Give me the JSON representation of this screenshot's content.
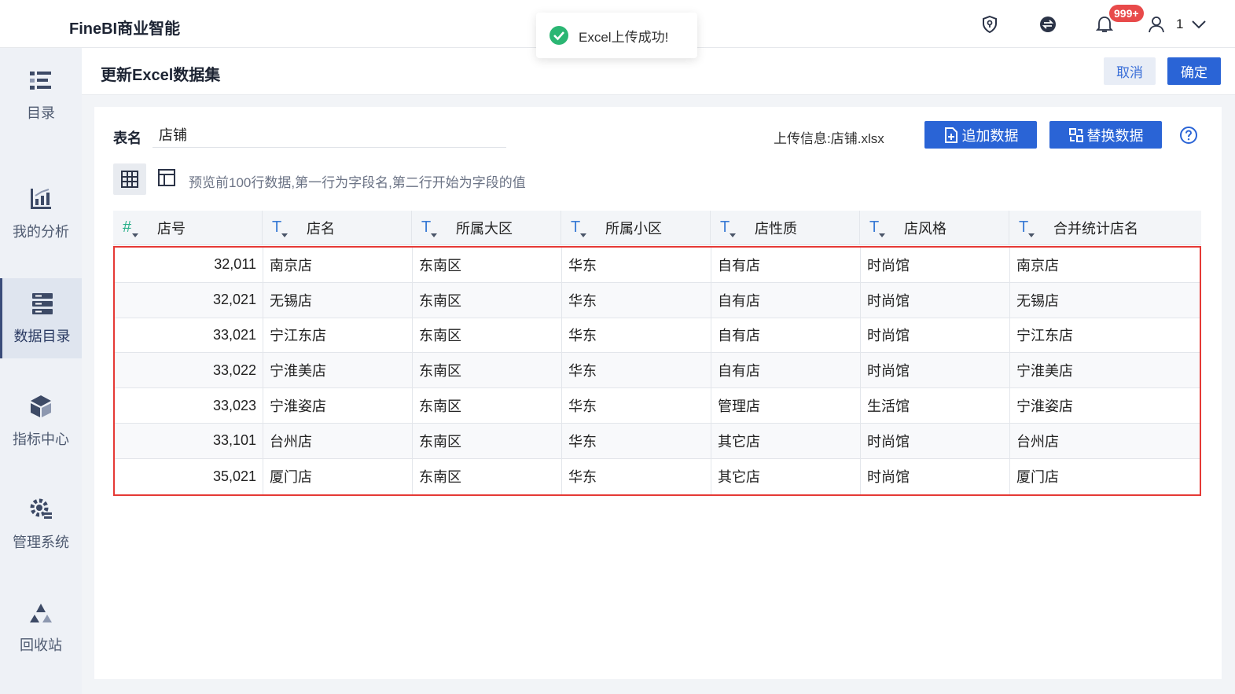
{
  "app": {
    "brand": "FineBI商业智能",
    "notification_badge": "999+",
    "user_name": "1"
  },
  "toast": {
    "message": "Excel上传成功!"
  },
  "sidebar": {
    "items": [
      {
        "label": "目录",
        "icon": "catalog-icon"
      },
      {
        "label": "我的分析",
        "icon": "analysis-icon"
      },
      {
        "label": "数据目录",
        "icon": "data-catalog-icon",
        "active": true
      },
      {
        "label": "指标中心",
        "icon": "metrics-icon"
      },
      {
        "label": "管理系统",
        "icon": "settings-icon"
      },
      {
        "label": "回收站",
        "icon": "recycle-icon"
      }
    ]
  },
  "header": {
    "title": "更新Excel数据集",
    "cancel_label": "取消",
    "ok_label": "确定"
  },
  "form": {
    "table_name_label": "表名",
    "table_name_value": "店铺",
    "upload_info": "上传信息:店铺.xlsx",
    "append_label": "追加数据",
    "replace_label": "替换数据",
    "preview_note": "预览前100行数据,第一行为字段名,第二行开始为字段的值"
  },
  "table": {
    "columns": [
      {
        "type": "#",
        "label": "店号"
      },
      {
        "type": "T",
        "label": "店名"
      },
      {
        "type": "T",
        "label": "所属大区"
      },
      {
        "type": "T",
        "label": "所属小区"
      },
      {
        "type": "T",
        "label": "店性质"
      },
      {
        "type": "T",
        "label": "店风格"
      },
      {
        "type": "T",
        "label": "合并统计店名"
      }
    ],
    "rows": [
      [
        "32,011",
        "南京店",
        "东南区",
        "华东",
        "自有店",
        "时尚馆",
        "南京店"
      ],
      [
        "32,021",
        "无锡店",
        "东南区",
        "华东",
        "自有店",
        "时尚馆",
        "无锡店"
      ],
      [
        "33,021",
        "宁江东店",
        "东南区",
        "华东",
        "自有店",
        "时尚馆",
        "宁江东店"
      ],
      [
        "33,022",
        "宁淮美店",
        "东南区",
        "华东",
        "自有店",
        "时尚馆",
        "宁淮美店"
      ],
      [
        "33,023",
        "宁淮姿店",
        "东南区",
        "华东",
        "管理店",
        "生活馆",
        "宁淮姿店"
      ],
      [
        "33,101",
        "台州店",
        "东南区",
        "华东",
        "其它店",
        "时尚馆",
        "台州店"
      ],
      [
        "35,021",
        "厦门店",
        "东南区",
        "华东",
        "其它店",
        "时尚馆",
        "厦门店"
      ]
    ]
  },
  "colors": {
    "primary": "#2a64d6",
    "highlight_border": "#e53935",
    "success": "#2bb673",
    "badge": "#e84a4a"
  }
}
